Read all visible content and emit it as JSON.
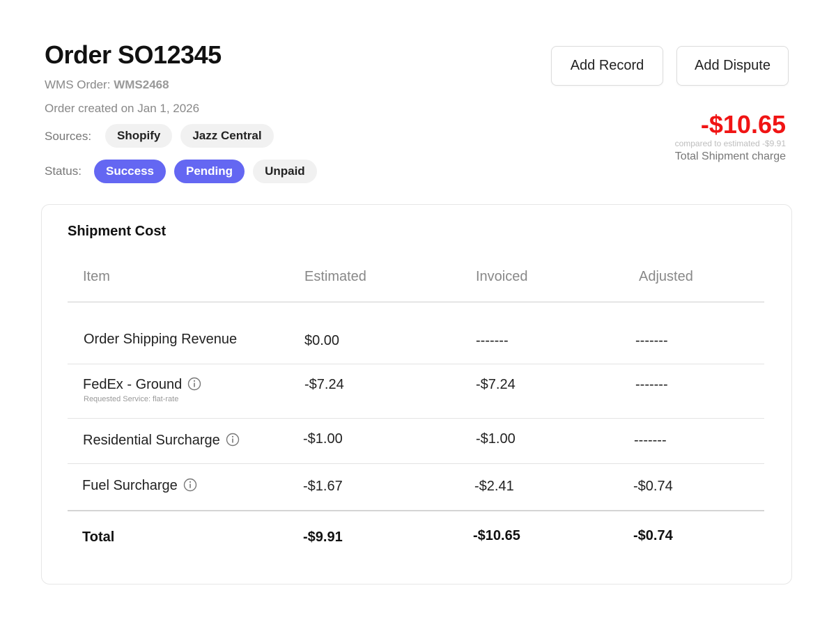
{
  "header": {
    "title": "Order SO12345",
    "wms_label": "WMS Order:",
    "wms_value": "WMS2468",
    "created": "Order created on Jan 1, 2026",
    "sources_label": "Sources:",
    "sources": [
      "Shopify",
      "Jazz Central"
    ],
    "status_label": "Status:",
    "statuses": [
      "Success",
      "Pending",
      "Unpaid"
    ]
  },
  "actions": {
    "add_record": "Add Record",
    "add_dispute": "Add Dispute"
  },
  "summary": {
    "amount": "-$10.65",
    "compare_note": "compared to estimated -$9.91",
    "label": "Total Shipment charge"
  },
  "card": {
    "title": "Shipment Cost",
    "columns": [
      "Item",
      "Estimated",
      "Invoiced",
      "Adjusted"
    ],
    "rows": [
      {
        "item": "Order Shipping Revenue",
        "note": "",
        "estimated": "$0.00",
        "invoiced": "-------",
        "adjusted": "-------"
      },
      {
        "item": "FedEx - Ground",
        "note": "Requested Service: flat-rate",
        "estimated": "-$7.24",
        "invoiced": "-$7.24",
        "adjusted": "-------"
      },
      {
        "item": "Residential Surcharge",
        "note": "",
        "estimated": "-$1.00",
        "invoiced": "-$1.00",
        "adjusted": "-------"
      },
      {
        "item": "Fuel Surcharge",
        "note": "",
        "estimated": "-$1.67",
        "invoiced": "-$2.41",
        "adjusted": "-$0.74"
      }
    ],
    "total": {
      "label": "Total",
      "estimated": "-$9.91",
      "invoiced": "-$10.65",
      "adjusted": "-$0.74"
    }
  },
  "colors": {
    "accent": "#6467f2",
    "negative_total": "#f01414"
  },
  "icons": [
    "info-icon"
  ]
}
